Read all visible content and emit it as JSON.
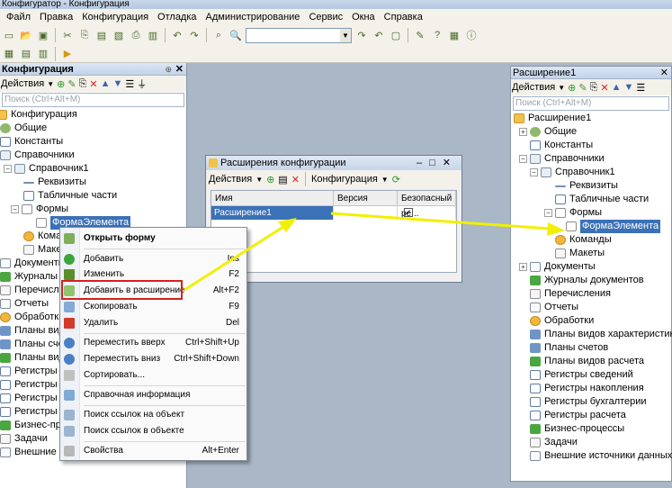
{
  "window": {
    "title": "Конфигуратор - Конфигурация"
  },
  "menu": [
    "Файл",
    "Правка",
    "Конфигурация",
    "Отладка",
    "Администрирование",
    "Сервис",
    "Окна",
    "Справка"
  ],
  "left_panel": {
    "title": "Конфигурация",
    "actions_label": "Действия",
    "search_placeholder": "Поиск (Ctrl+Alt+M)",
    "tree": [
      "Конфигурация",
      "Общие",
      "Константы",
      "Справочники",
      "Справочник1",
      "Реквизиты",
      "Табличные части",
      "Формы",
      "ФормаЭлемента",
      "Команды",
      "Макеты",
      "Документы",
      "Журналы документов",
      "Перечисления",
      "Отчеты",
      "Обработки",
      "Планы видов характеристик",
      "Планы счетов",
      "Планы видов расчета",
      "Регистры сведений",
      "Регистры накопления",
      "Регистры бухгалтерии",
      "Регистры расчета",
      "Бизнес-процессы",
      "Задачи",
      "Внешние источники данных"
    ]
  },
  "context_menu": {
    "items": [
      {
        "label": "Открыть форму",
        "key": ""
      },
      {
        "label": "Добавить",
        "key": "Ins"
      },
      {
        "label": "Изменить",
        "key": "F2"
      },
      {
        "label": "Добавить в расширение",
        "key": "Alt+F2"
      },
      {
        "label": "Скопировать",
        "key": "F9"
      },
      {
        "label": "Удалить",
        "key": "Del"
      },
      {
        "label": "Переместить вверх",
        "key": "Ctrl+Shift+Up"
      },
      {
        "label": "Переместить вниз",
        "key": "Ctrl+Shift+Down"
      },
      {
        "label": "Сортировать...",
        "key": ""
      },
      {
        "label": "Справочная информация",
        "key": ""
      },
      {
        "label": "Поиск ссылок на объект",
        "key": ""
      },
      {
        "label": "Поиск ссылок в объекте",
        "key": ""
      },
      {
        "label": "Свойства",
        "key": "Alt+Enter"
      }
    ]
  },
  "extensions_dialog": {
    "title": "Расширения конфигурации",
    "actions_label": "Действия",
    "config_label": "Конфигурация",
    "columns": [
      "Имя",
      "Версия",
      "Безопасный ре..."
    ],
    "rows": [
      {
        "name": "Расширение1",
        "version": "",
        "safe": "✓"
      }
    ]
  },
  "right_panel": {
    "title": "Расширение1",
    "actions_label": "Действия",
    "search_placeholder": "Поиск (Ctrl+Alt+M)",
    "tree": [
      "Расширение1",
      "Общие",
      "Константы",
      "Справочники",
      "Справочник1",
      "Реквизиты",
      "Табличные части",
      "Формы",
      "ФормаЭлемента",
      "Команды",
      "Макеты",
      "Документы",
      "Журналы документов",
      "Перечисления",
      "Отчеты",
      "Обработки",
      "Планы видов характеристик",
      "Планы счетов",
      "Планы видов расчета",
      "Регистры сведений",
      "Регистры накопления",
      "Регистры бухгалтерии",
      "Регистры расчета",
      "Бизнес-процессы",
      "Задачи",
      "Внешние источники данных"
    ]
  },
  "colors": {
    "selection": "#3b71b7",
    "highlight_box": "#d4211e",
    "arrow": "#f0f000"
  }
}
